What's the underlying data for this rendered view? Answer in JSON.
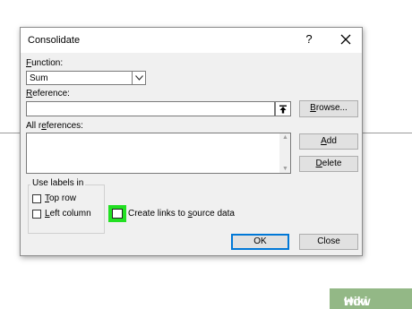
{
  "dialog": {
    "title": "Consolidate",
    "help_glyph": "?",
    "function": {
      "label_underlined": "F",
      "label_rest": "unction:",
      "value": "Sum"
    },
    "reference": {
      "label_underlined": "R",
      "label_rest": "eference:",
      "value": ""
    },
    "all_references": {
      "label_start": "All r",
      "label_underlined": "e",
      "label_rest": "ferences:",
      "items": []
    },
    "buttons": {
      "browse": {
        "underlined": "B",
        "rest": "rowse..."
      },
      "add": {
        "underlined": "A",
        "rest": "dd"
      },
      "delete": {
        "underlined": "D",
        "rest": "elete"
      },
      "ok": "OK",
      "close": "Close"
    },
    "use_labels": {
      "title": "Use labels in",
      "top_row": {
        "underlined": "T",
        "rest": "op row",
        "checked": false
      },
      "left_column": {
        "underlined": "L",
        "rest": "eft column",
        "checked": false
      }
    },
    "create_links": {
      "label_start": "Create links to ",
      "label_underlined": "s",
      "label_rest": "ource data",
      "checked": false,
      "highlight_color": "#22e022"
    },
    "default_button_color": "#0078d7"
  },
  "watermark": {
    "wiki": "wiki",
    "how": "How",
    "color": "#93b886"
  }
}
